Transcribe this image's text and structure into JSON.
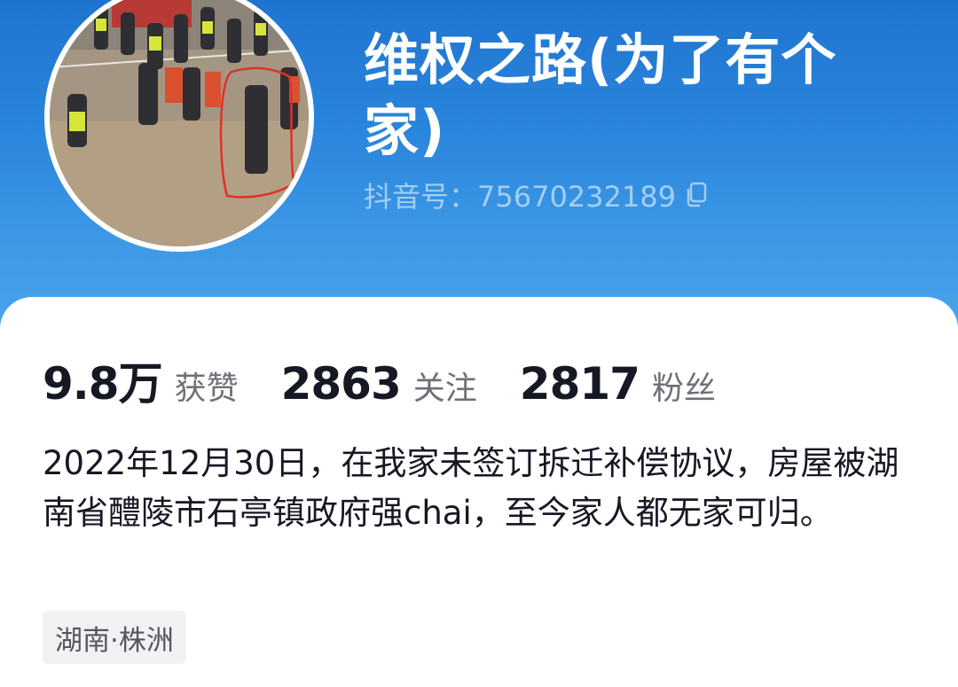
{
  "profile": {
    "nickname": "维权之路(为了有个家)",
    "douyin_id": "抖音号：75670232189"
  },
  "stats": [
    {
      "value": "9.8万",
      "label": "获赞"
    },
    {
      "value": "2863",
      "label": "关注"
    },
    {
      "value": "2817",
      "label": "粉丝"
    }
  ],
  "bio": "2022年12月30日，在我家未签订拆迁补偿协议，房屋被湖南省醴陵市石亭镇政府强chai，至今家人都无家可归。",
  "location": "湖南·株洲",
  "colors": {
    "header_blue": "#2b86dd",
    "text_primary": "#161823",
    "text_secondary": "#6f7077"
  },
  "icons": [
    "copy-icon"
  ]
}
